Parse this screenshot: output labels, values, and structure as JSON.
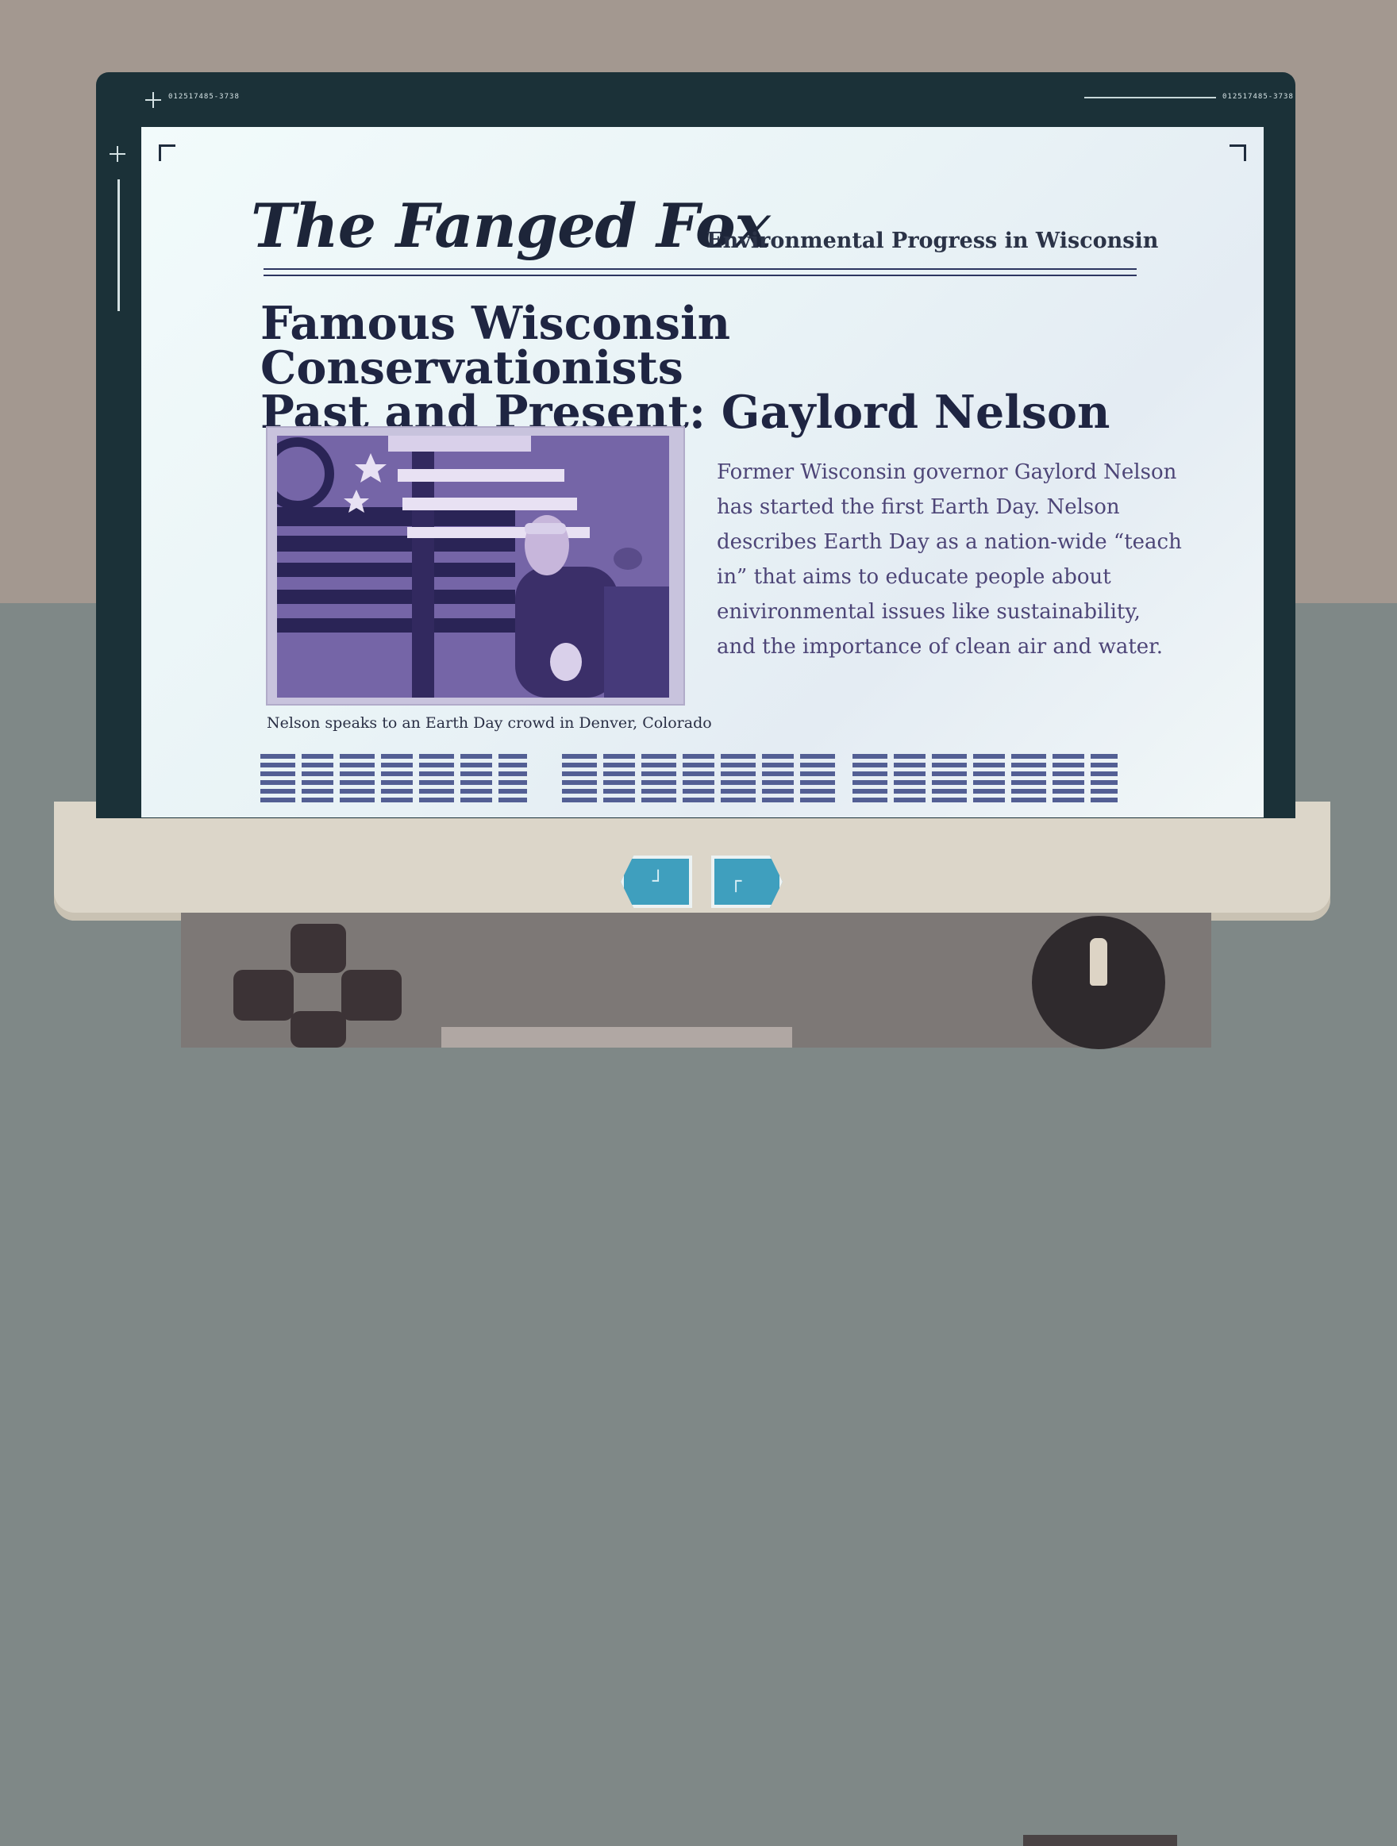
{
  "newspaper": {
    "masthead": "The Fanged Fox",
    "subtitle": "Environmental Progress in Wisconsin",
    "headline_line1": "Famous Wisconsin Conservationists",
    "headline_line2": "Past and Present: Gaylord Nelson",
    "caption": "Nelson speaks to an Earth Day crowd in Denver, Colorado",
    "article_lines": [
      "Former Wisconsin governor Gaylord Nelson",
      "has started the first Earth Day. Nelson",
      "describes Earth Day as a nation-wide “teach",
      "in” that aims to educate people about",
      "enivironmental issues like sustainability,",
      "and the importance of clean air and water."
    ]
  },
  "screen": {
    "ticker_left": "012517485-3738",
    "ticker_right": "012517485-3738"
  },
  "controls": {
    "prev_glyph": "┘",
    "next_glyph": "┌",
    "button_color": "#3f9fbe"
  },
  "colors": {
    "paper": "#eef7f8",
    "ink": "#1f2542",
    "article_text": "#4d4577"
  }
}
